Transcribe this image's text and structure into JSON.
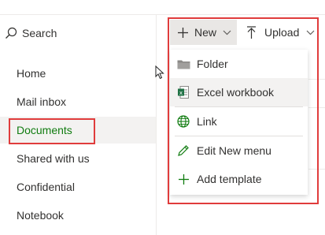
{
  "search": {
    "label": "Search"
  },
  "nav": {
    "items": [
      {
        "label": "Home"
      },
      {
        "label": "Mail inbox"
      },
      {
        "label": "Documents"
      },
      {
        "label": "Shared with us"
      },
      {
        "label": "Confidential"
      },
      {
        "label": "Notebook"
      }
    ],
    "selected": "Documents"
  },
  "commandbar": {
    "new_label": "New",
    "upload_label": "Upload"
  },
  "new_menu": {
    "items": [
      {
        "label": "Folder",
        "icon": "folder-icon"
      },
      {
        "label": "Excel workbook",
        "icon": "excel-icon"
      },
      {
        "label": "Link",
        "icon": "globe-icon"
      },
      {
        "label": "Edit New menu",
        "icon": "pencil-icon"
      },
      {
        "label": "Add template",
        "icon": "plus-icon"
      }
    ]
  },
  "colors": {
    "accent_green": "#107c10",
    "highlight_red": "#e03c3c",
    "selected_bg": "#f3f2f1"
  }
}
